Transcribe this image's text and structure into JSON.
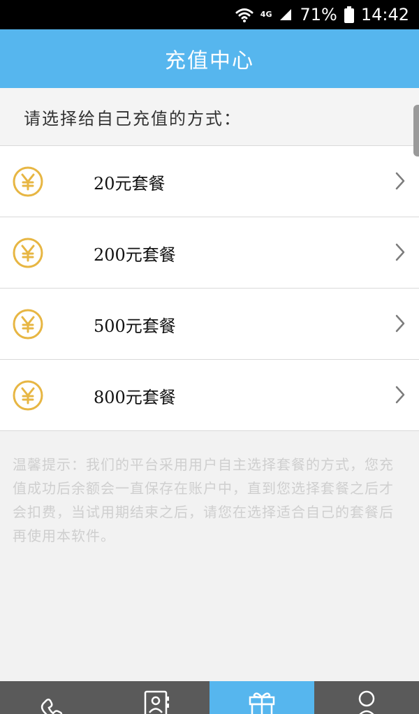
{
  "status_bar": {
    "network": "4G",
    "battery": "71%",
    "time": "14:42"
  },
  "header": {
    "title": "充值中心"
  },
  "section": {
    "label": "请选择给自己充值的方式："
  },
  "packages": [
    {
      "label": "20元套餐",
      "icon": "yen-coin-icon"
    },
    {
      "label": "200元套餐",
      "icon": "yen-coin-icon"
    },
    {
      "label": "500元套餐",
      "icon": "yen-coin-icon"
    },
    {
      "label": "800元套餐",
      "icon": "yen-coin-icon"
    }
  ],
  "tip": {
    "text": "温馨提示：我们的平台采用用户自主选择套餐的方式，您充值成功后余额会一直保存在账户中，直到您选择套餐之后才会扣费，当试用期结束之后，请您在选择适合自己的套餐后再使用本软件。"
  },
  "bottom_nav": [
    {
      "icon": "phone-icon",
      "active": false
    },
    {
      "icon": "contacts-icon",
      "active": false
    },
    {
      "icon": "gift-icon",
      "active": true
    },
    {
      "icon": "user-icon",
      "active": false
    }
  ],
  "colors": {
    "primary": "#56b6ee",
    "coin": "#e7b643",
    "background": "#f2f2f2",
    "tip_text": "#cfcfcf"
  }
}
